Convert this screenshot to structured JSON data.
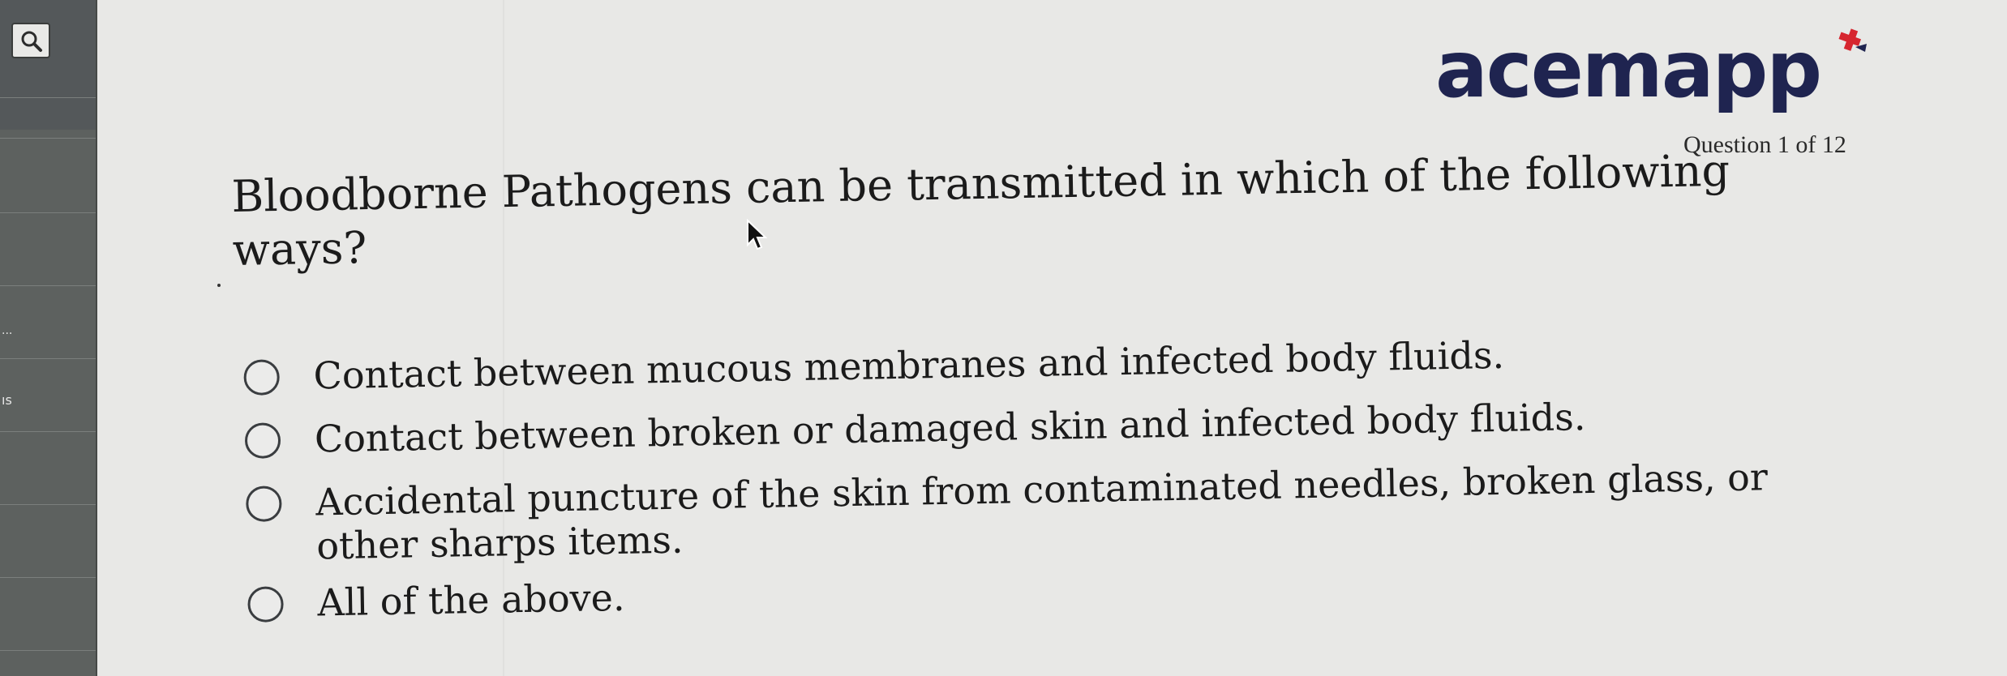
{
  "app": {
    "brand": "acemapp",
    "progress": "Question 1 of 12"
  },
  "sidebar": {
    "label_fragment_1": "...",
    "label_fragment_2": "ıs"
  },
  "quiz": {
    "question": "Bloodborne Pathogens can be transmitted in which of the following ways?",
    "options": [
      {
        "label": "Contact between mucous membranes and infected body fluids.",
        "selected": false
      },
      {
        "label": "Contact between broken or damaged skin and infected body fluids.",
        "selected": false
      },
      {
        "label": "Accidental puncture of the skin from contaminated needles, broken glass, or other sharps items.",
        "selected": false
      },
      {
        "label": "All of the above.",
        "selected": false
      }
    ]
  },
  "colors": {
    "brand_navy": "#1f2450",
    "brand_red": "#d6262f",
    "sidebar_bg": "#5d615f"
  },
  "icons": [
    "search-icon",
    "brand-plus-icon",
    "mouse-cursor-icon"
  ]
}
